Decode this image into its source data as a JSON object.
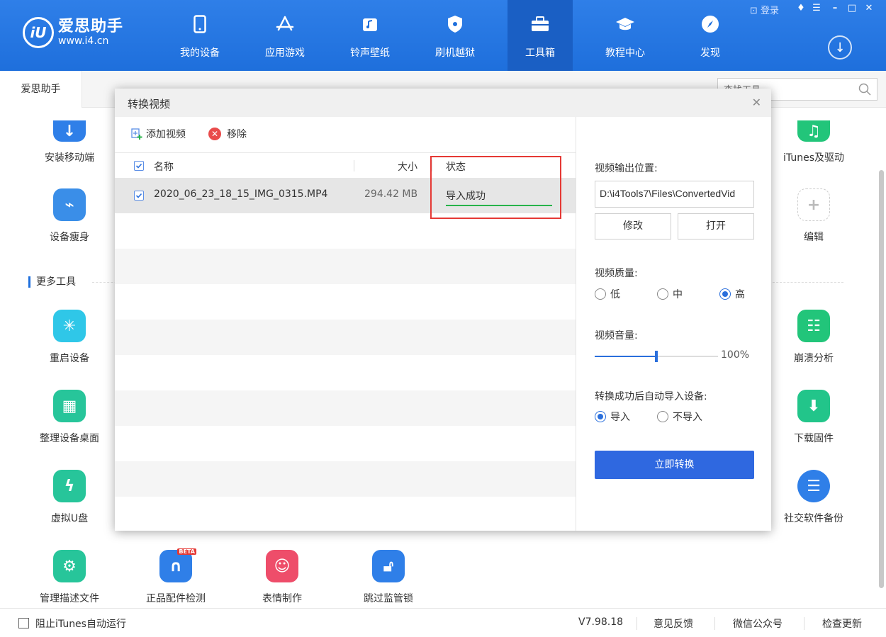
{
  "app": {
    "logo_mark": "iU",
    "title": "爱思助手",
    "url": "www.i4.cn",
    "login": "登录",
    "nav": [
      {
        "label": "我的设备",
        "icon": "phone-icon"
      },
      {
        "label": "应用游戏",
        "icon": "appstore-icon"
      },
      {
        "label": "铃声壁纸",
        "icon": "music-icon"
      },
      {
        "label": "刷机越狱",
        "icon": "shield-icon"
      },
      {
        "label": "工具箱",
        "icon": "toolbox-icon"
      },
      {
        "label": "教程中心",
        "icon": "graduation-cap-icon"
      },
      {
        "label": "发现",
        "icon": "compass-icon"
      }
    ],
    "active_nav": "工具箱"
  },
  "tabs": {
    "home": "爱思助手",
    "search_placeholder": "查找工具"
  },
  "tools": {
    "row1": [
      {
        "label": "安装移动端",
        "color": "#2f7fe8"
      },
      {
        "label": "iTunes及驱动",
        "color": "#22c57a"
      }
    ],
    "row2": [
      {
        "label": "设备瘦身",
        "color": "#3a8ee8"
      },
      {
        "label": "编辑",
        "color": "#ffffff"
      }
    ],
    "section_title": "更多工具",
    "row3": [
      {
        "label": "重启设备",
        "color": "#2fc7e8"
      },
      {
        "label": "崩溃分析",
        "color": "#22c57a"
      }
    ],
    "row4": [
      {
        "label": "整理设备桌面",
        "color": "#27c59a"
      },
      {
        "label": "下载固件",
        "color": "#22c58a"
      }
    ],
    "row5": [
      {
        "label": "虚拟U盘",
        "color": "#27c59a"
      },
      {
        "label": "社交软件备份",
        "color": "#2f7fe8"
      }
    ],
    "row6": [
      {
        "label": "管理描述文件",
        "color": "#27c59a"
      },
      {
        "label": "正品配件检测",
        "color": "#2f7fe8",
        "badge": "BETA"
      },
      {
        "label": "表情制作",
        "color": "#ee4d6a"
      },
      {
        "label": "跳过监管锁",
        "color": "#2f7fe8"
      }
    ]
  },
  "footer": {
    "itunes_check": "阻止iTunes自动运行",
    "version": "V7.98.18",
    "feedback": "意见反馈",
    "wechat": "微信公众号",
    "update": "检查更新"
  },
  "modal": {
    "title": "转换视频",
    "add_video": "添加视频",
    "remove": "移除",
    "columns": {
      "name": "名称",
      "size": "大小",
      "status": "状态"
    },
    "files": [
      {
        "name": "2020_06_23_18_15_IMG_0315.MP4",
        "size": "294.42 MB",
        "status": "导入成功",
        "checked": true
      }
    ],
    "output_label": "视频输出位置:",
    "output_path": "D:\\i4Tools7\\Files\\ConvertedVid",
    "modify": "修改",
    "open": "打开",
    "quality_label": "视频质量:",
    "quality_options": [
      "低",
      "中",
      "高"
    ],
    "quality_selected": "高",
    "volume_label": "视频音量:",
    "volume_value": "100%",
    "volume_fraction": 0.5,
    "auto_import_label": "转换成功后自动导入设备:",
    "import_options": [
      "导入",
      "不导入"
    ],
    "import_selected": "导入",
    "convert_button": "立即转换"
  }
}
